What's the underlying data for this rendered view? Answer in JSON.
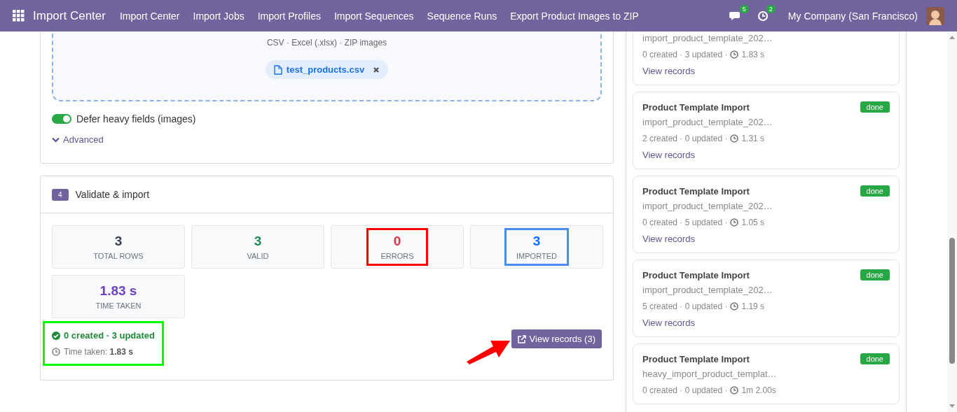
{
  "navbar": {
    "app_title": "Import Center",
    "menu": [
      {
        "label": "Import Center"
      },
      {
        "label": "Import Jobs"
      },
      {
        "label": "Import Profiles"
      },
      {
        "label": "Import Sequences"
      },
      {
        "label": "Sequence Runs"
      },
      {
        "label": "Export Product Images to ZIP"
      }
    ],
    "messages_count": "5",
    "activities_count": "2",
    "company": "My Company (San Francisco)"
  },
  "upload": {
    "hint": "CSV · Excel (.xlsx) · ZIP images",
    "file": "test_products.csv",
    "defer_toggle": {
      "label": "Defer heavy fields (images)",
      "on": true
    },
    "advanced": {
      "label": "Advanced",
      "expanded": false
    }
  },
  "validate": {
    "step": "4",
    "title": "Validate & import",
    "stats": [
      {
        "value": "3",
        "label": "TOTAL ROWS",
        "color": "#374151"
      },
      {
        "value": "3",
        "label": "VALID",
        "color": "#1e8a55"
      },
      {
        "value": "0",
        "label": "ERRORS",
        "color": "#dc3545",
        "highlight": {
          "color": "#ff0000"
        }
      },
      {
        "value": "3",
        "label": "IMPORTED",
        "color": "#0d6efd",
        "highlight": {
          "color": "#4a8cf0"
        }
      },
      {
        "value": "1.83 s",
        "label": "TIME TAKEN",
        "color": "#6f42c1"
      }
    ],
    "result": {
      "summary": "0 created · 3 updated",
      "time": "Time taken: **1.83 s**",
      "highlight": {
        "color": "#00ff00"
      }
    },
    "view_button": "View records (3)",
    "annotations": [
      {
        "kind": "arrow",
        "color": "#ff0000"
      }
    ]
  },
  "history": [
    {
      "file": "import_product_template_202…",
      "stats": "0 created · 3 updated ·",
      "time": "1.83 s",
      "link": "View records"
    },
    {
      "title": "Product Template Import",
      "status": "done",
      "file": "import_product_template_202…",
      "stats": "2 created · 0 updated ·",
      "time": "1.31 s",
      "link": "View records"
    },
    {
      "title": "Product Template Import",
      "status": "done",
      "file": "import_product_template_202…",
      "stats": "0 created · 5 updated ·",
      "time": "1.05 s",
      "link": "View records"
    },
    {
      "title": "Product Template Import",
      "status": "done",
      "file": "import_product_template_202…",
      "stats": "5 created · 0 updated ·",
      "time": "1.19 s",
      "link": "View records"
    },
    {
      "title": "Product Template Import",
      "status": "done",
      "file": "heavy_import_product_templat…",
      "stats": "0 created · 0 updated ·",
      "time": "1m 2.00s"
    }
  ]
}
